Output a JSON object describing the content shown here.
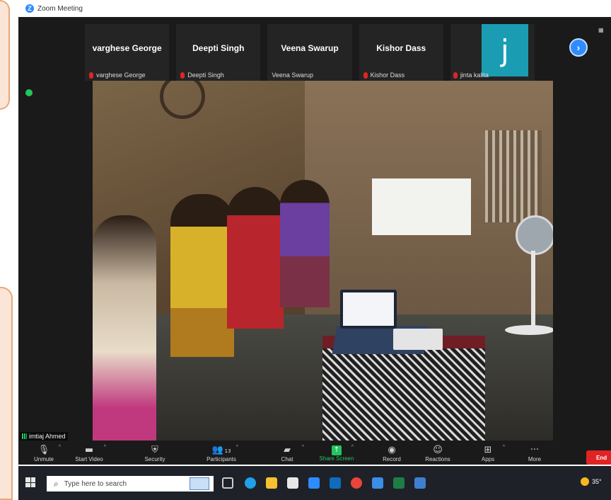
{
  "window": {
    "title": "Zoom Meeting"
  },
  "thumbnails": [
    {
      "name": "varghese George",
      "sub": "varghese George",
      "muted": true
    },
    {
      "name": "Deepti Singh",
      "sub": "Deepti Singh",
      "muted": true
    },
    {
      "name": "Veena Swarup",
      "sub": "Veena Swarup",
      "muted": false
    },
    {
      "name": "Kishor Dass",
      "sub": "Kishor Dass",
      "muted": true
    },
    {
      "name": "",
      "avatar_letter": "j",
      "sub": "jinta kalita",
      "muted": true
    }
  ],
  "active_speaker": {
    "label": "imtiaj Ahmed"
  },
  "toolbar": {
    "unmute": "Unmute",
    "start_video": "Start Video",
    "security": "Security",
    "participants": "Participants",
    "participants_count": "13",
    "chat": "Chat",
    "share_screen": "Share Screen",
    "record": "Record",
    "reactions": "Reactions",
    "apps": "Apps",
    "more": "More",
    "end": "End"
  },
  "taskbar": {
    "search_placeholder": "Type here to search",
    "weather_temp": "35°"
  },
  "colors": {
    "zoom_blue": "#2d8cff",
    "share_green": "#22c55e",
    "end_red": "#e02424",
    "avatar_teal": "#1a9db3"
  }
}
